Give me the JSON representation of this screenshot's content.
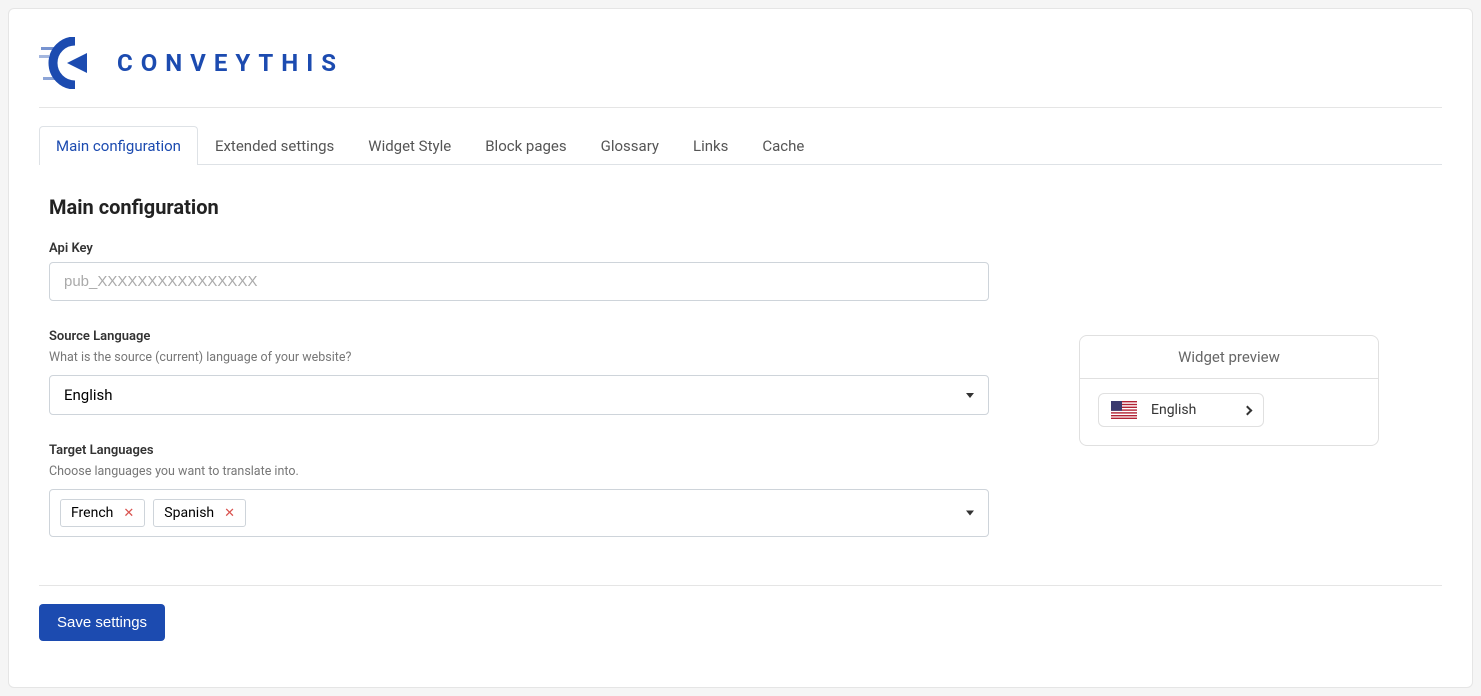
{
  "brand": {
    "name": "CONVEYTHIS",
    "accent": "#1c4bb0"
  },
  "tabs": [
    {
      "label": "Main configuration",
      "active": true
    },
    {
      "label": "Extended settings",
      "active": false
    },
    {
      "label": "Widget Style",
      "active": false
    },
    {
      "label": "Block pages",
      "active": false
    },
    {
      "label": "Glossary",
      "active": false
    },
    {
      "label": "Links",
      "active": false
    },
    {
      "label": "Cache",
      "active": false
    }
  ],
  "page_title": "Main configuration",
  "api_key": {
    "label": "Api Key",
    "placeholder": "pub_XXXXXXXXXXXXXXXX",
    "value": ""
  },
  "source_language": {
    "label": "Source Language",
    "help": "What is the source (current) language of your website?",
    "value": "English"
  },
  "target_languages": {
    "label": "Target Languages",
    "help": "Choose languages you want to translate into.",
    "values": [
      "French",
      "Spanish"
    ]
  },
  "widget_preview": {
    "title": "Widget preview",
    "language": "English",
    "flag": "us"
  },
  "save_button": "Save settings"
}
